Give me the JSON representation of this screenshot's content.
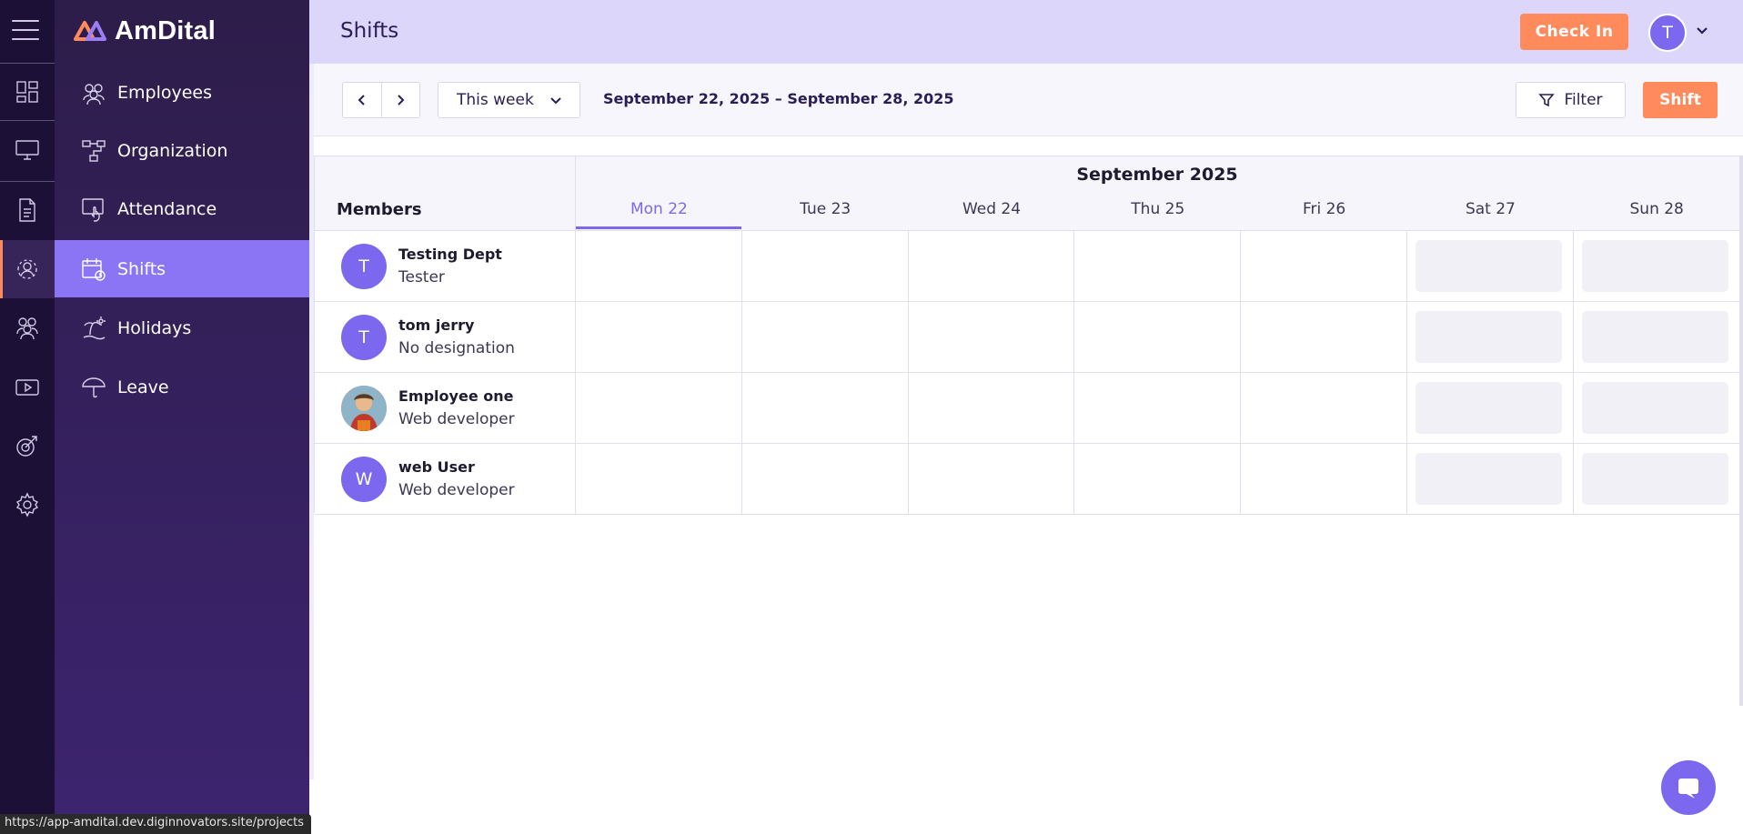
{
  "app": {
    "name": "AmDital",
    "brand_color": "#ff8a5c",
    "accent_color": "#7b68ee"
  },
  "rail": {
    "items": [
      {
        "icon": "dashboard-icon"
      },
      {
        "icon": "monitor-icon"
      },
      {
        "icon": "document-icon"
      },
      {
        "icon": "people-circle-icon",
        "active": true
      },
      {
        "icon": "team-icon"
      },
      {
        "icon": "video-icon"
      },
      {
        "icon": "target-icon"
      },
      {
        "icon": "gear-icon"
      }
    ]
  },
  "sidebar": {
    "items": [
      {
        "label": "Employees",
        "icon": "employees-icon"
      },
      {
        "label": "Organization",
        "icon": "org-chart-icon"
      },
      {
        "label": "Attendance",
        "icon": "attendance-icon"
      },
      {
        "label": "Shifts",
        "icon": "calendar-clock-icon",
        "active": true
      },
      {
        "label": "Holidays",
        "icon": "beach-icon"
      },
      {
        "label": "Leave",
        "icon": "umbrella-icon"
      }
    ]
  },
  "header": {
    "title": "Shifts",
    "check_in_label": "Check In",
    "user_initial": "T"
  },
  "toolbar": {
    "range_label": "This week",
    "date_range": "September 22, 2025 – September 28, 2025",
    "filter_label": "Filter",
    "shift_label": "Shift"
  },
  "schedule": {
    "members_label": "Members",
    "month": "September 2025",
    "days": [
      "Mon 22",
      "Tue 23",
      "Wed 24",
      "Thu 25",
      "Fri 26",
      "Sat 27",
      "Sun 28"
    ],
    "members": [
      {
        "initial": "T",
        "name": "Testing Dept",
        "role": "Tester"
      },
      {
        "initial": "T",
        "name": "tom jerry",
        "role": "No designation"
      },
      {
        "initial": "",
        "name": "Employee one",
        "role": "Web developer"
      },
      {
        "initial": "W",
        "name": "web User",
        "role": "Web developer"
      }
    ]
  },
  "status_bar": {
    "url": "https://app-amdital.dev.diginnovators.site/projects"
  }
}
